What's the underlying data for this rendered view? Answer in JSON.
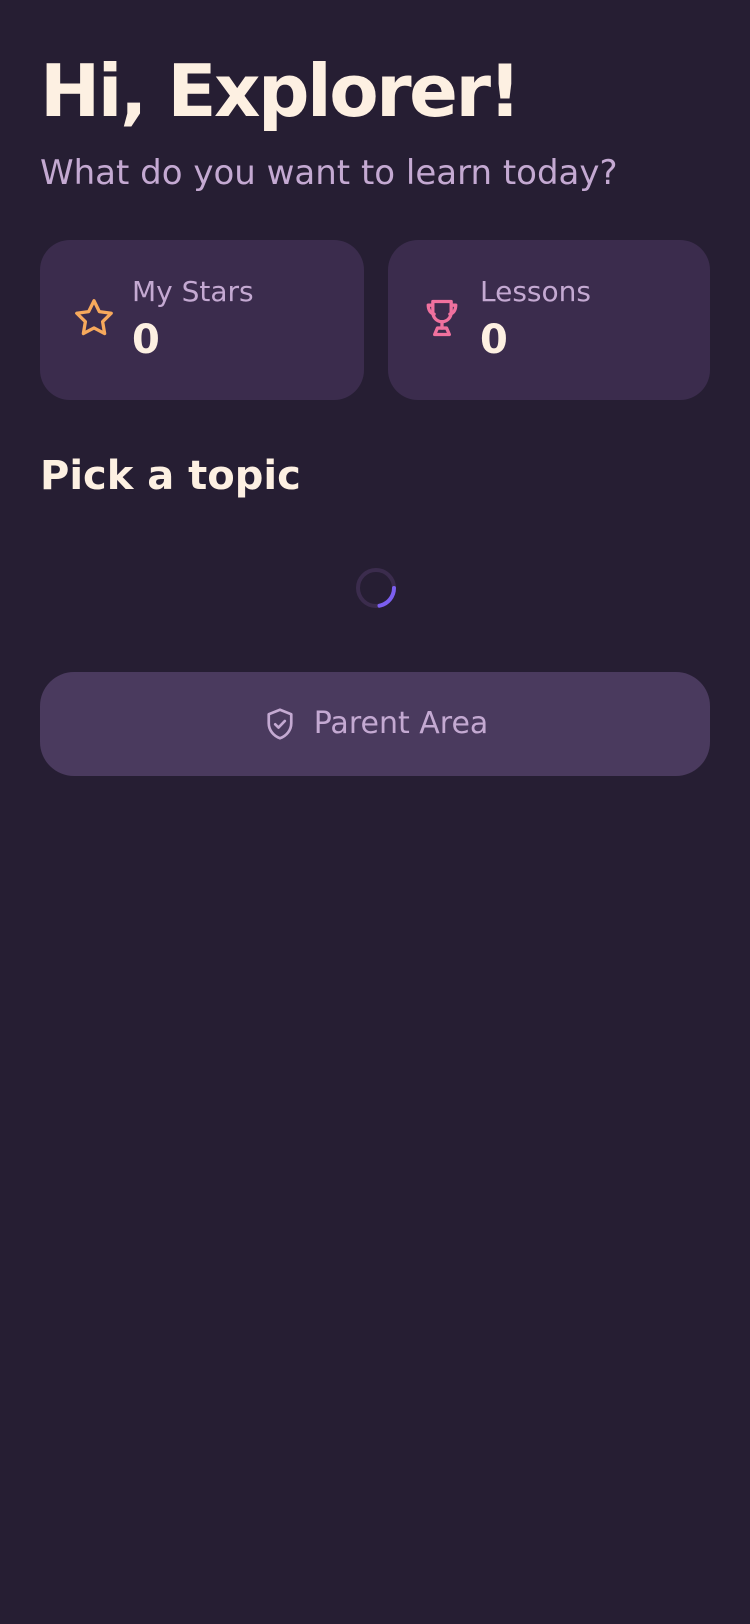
{
  "header": {
    "greeting": "Hi, Explorer!",
    "subtitle": "What do you want to learn today?"
  },
  "stats": {
    "stars": {
      "label": "My Stars",
      "value": "0",
      "icon": "star-icon",
      "color": "#f7a95c"
    },
    "lessons": {
      "label": "Lessons",
      "value": "0",
      "icon": "trophy-icon",
      "color": "#f0719e"
    }
  },
  "topics": {
    "title": "Pick a topic",
    "loading_indicator": "loading-spinner-icon",
    "spinner_color": "#7c5ff0"
  },
  "parent_area": {
    "label": "Parent Area",
    "icon": "shield-check-icon"
  },
  "colors": {
    "background": "#261e33",
    "card": "#3b2c4d",
    "button": "#4a3a5e",
    "text_primary": "#fdf0e2",
    "text_secondary": "#c4a9d2"
  }
}
